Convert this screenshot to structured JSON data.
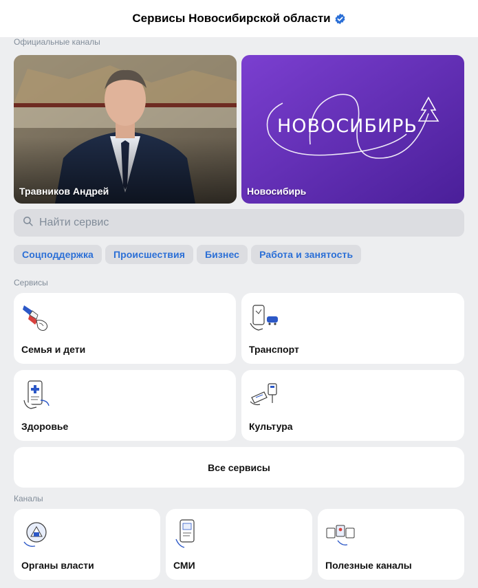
{
  "header": {
    "title": "Сервисы Новосибирской области",
    "verified_icon": "verified-badge-icon"
  },
  "official": {
    "label": "Официальные каналы",
    "channels": [
      {
        "name": "Травников Андрей"
      },
      {
        "name": "Новосибирь",
        "logo_text": "НОВОСИБИРЬ"
      }
    ]
  },
  "search": {
    "placeholder": "Найти сервис",
    "value": ""
  },
  "chips": [
    "Соцподдержка",
    "Происшествия",
    "Бизнес",
    "Работа и занятость"
  ],
  "services": {
    "label": "Сервисы",
    "items": [
      {
        "label": "Семья и дети",
        "icon": "family-icon"
      },
      {
        "label": "Транспорт",
        "icon": "transport-icon"
      },
      {
        "label": "Здоровье",
        "icon": "health-icon"
      },
      {
        "label": "Культура",
        "icon": "culture-icon"
      }
    ],
    "all_label": "Все сервисы"
  },
  "channels": {
    "label": "Каналы",
    "items": [
      {
        "label": "Органы власти",
        "icon": "government-icon"
      },
      {
        "label": "СМИ",
        "icon": "media-icon"
      },
      {
        "label": "Полезные каналы",
        "icon": "useful-channels-icon"
      }
    ]
  },
  "colors": {
    "accent": "#2b6fd6",
    "background": "#edeef0",
    "card": "#ffffff",
    "brand_purple": "#6a30c0"
  }
}
